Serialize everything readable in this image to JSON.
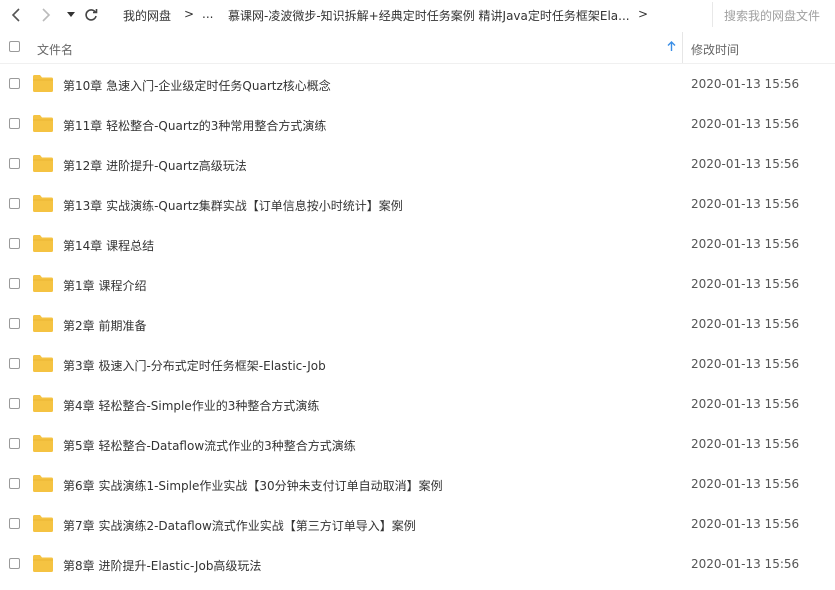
{
  "toolbar": {
    "back_icon": "chevron-left-icon",
    "forward_icon": "chevron-right-icon",
    "dropdown_icon": "caret-down-icon",
    "refresh_icon": "refresh-icon",
    "breadcrumb": {
      "root": "我的网盘",
      "sep1": ">",
      "ellipsis": "...",
      "current": "慕课网-凌波微步-知识拆解+经典定时任务案例 精讲Java定时任务框架Ela...",
      "sep2": ">"
    },
    "search_placeholder": "搜索我的网盘文件"
  },
  "header": {
    "name_label": "文件名",
    "date_label": "修改时间",
    "sort_icon": "arrow-up-icon"
  },
  "colors": {
    "folder": "#f5c342",
    "accent": "#3a8ee6"
  },
  "files": [
    {
      "name": "第10章 急速入门-企业级定时任务Quartz核心概念",
      "modified": "2020-01-13 15:56"
    },
    {
      "name": "第11章 轻松整合-Quartz的3种常用整合方式演练",
      "modified": "2020-01-13 15:56"
    },
    {
      "name": "第12章 进阶提升-Quartz高级玩法",
      "modified": "2020-01-13 15:56"
    },
    {
      "name": "第13章 实战演练-Quartz集群实战【订单信息按小时统计】案例",
      "modified": "2020-01-13 15:56"
    },
    {
      "name": "第14章 课程总结",
      "modified": "2020-01-13 15:56"
    },
    {
      "name": "第1章 课程介绍",
      "modified": "2020-01-13 15:56"
    },
    {
      "name": "第2章 前期准备",
      "modified": "2020-01-13 15:56"
    },
    {
      "name": "第3章 极速入门-分布式定时任务框架-Elastic-Job",
      "modified": "2020-01-13 15:56"
    },
    {
      "name": "第4章 轻松整合-Simple作业的3种整合方式演练",
      "modified": "2020-01-13 15:56"
    },
    {
      "name": "第5章 轻松整合-Dataflow流式作业的3种整合方式演练",
      "modified": "2020-01-13 15:56"
    },
    {
      "name": "第6章 实战演练1-Simple作业实战【30分钟未支付订单自动取消】案例",
      "modified": "2020-01-13 15:56"
    },
    {
      "name": "第7章 实战演练2-Dataflow流式作业实战【第三方订单导入】案例",
      "modified": "2020-01-13 15:56"
    },
    {
      "name": "第8章 进阶提升-Elastic-Job高级玩法",
      "modified": "2020-01-13 15:56"
    }
  ]
}
